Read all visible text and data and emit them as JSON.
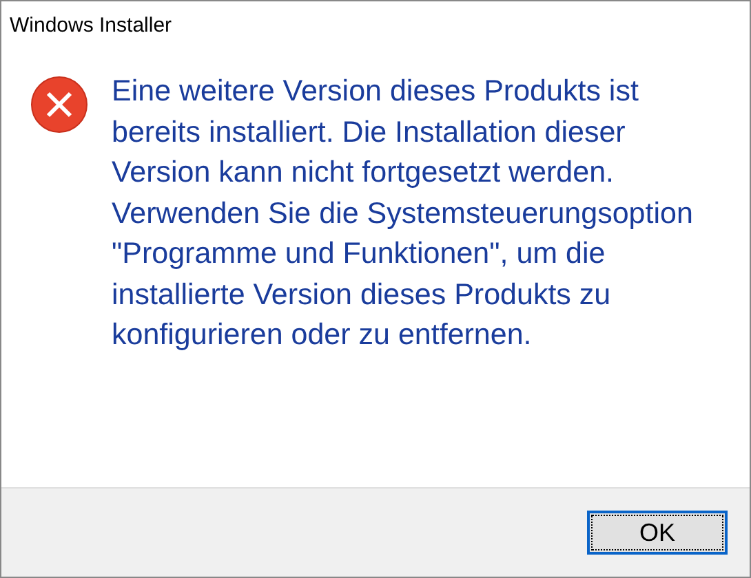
{
  "window": {
    "title": "Windows Installer"
  },
  "message": {
    "kind": "error",
    "text": "Eine weitere Version dieses Produkts ist bereits installiert. Die Installation dieser Version kann nicht fortgesetzt werden. Verwenden Sie die Systemsteuerungsoption \"Programme und Funktionen\", um die installierte Version dieses Produkts zu konfigurieren oder zu entfernen."
  },
  "buttons": [
    {
      "label": "OK",
      "selected": true
    }
  ]
}
